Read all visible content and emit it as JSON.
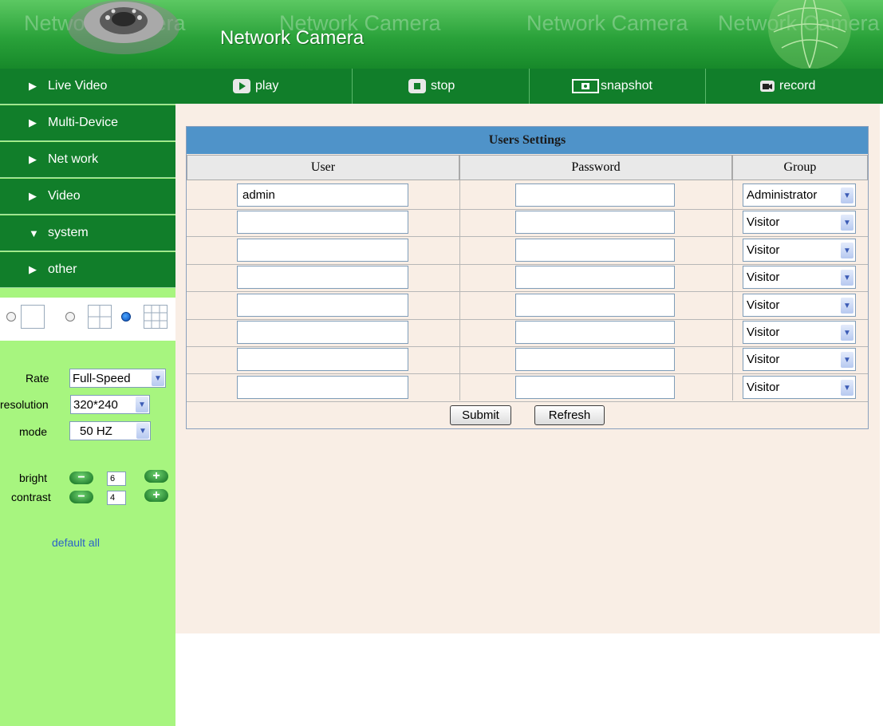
{
  "header": {
    "title": "Network Camera",
    "watermark": "Network Camera"
  },
  "toolbar": {
    "play_label": "play",
    "stop_label": "stop",
    "snapshot_label": "snapshot",
    "record_label": "record"
  },
  "sidebar": {
    "items": [
      {
        "label": "Live Video",
        "arrow": "▶"
      },
      {
        "label": "Multi-Device",
        "arrow": "▶"
      },
      {
        "label": "Net work",
        "arrow": "▶"
      },
      {
        "label": "Video",
        "arrow": "▶"
      },
      {
        "label": "system",
        "arrow": "▼"
      },
      {
        "label": "other",
        "arrow": "▶"
      }
    ],
    "view_mode_selected": 3,
    "rate_label": "Rate",
    "rate_value": "Full-Speed",
    "resolution_label": "resolution",
    "resolution_value": "320*240",
    "mode_label": "mode",
    "mode_value": "50 HZ",
    "bright_label": "bright",
    "bright_value": "6",
    "contrast_label": "contrast",
    "contrast_value": "4",
    "default_all": "default all"
  },
  "settings": {
    "title": "Users Settings",
    "columns": [
      "User",
      "Password",
      "Group"
    ],
    "rows": [
      {
        "user": "admin",
        "password": "",
        "group": "Administrator"
      },
      {
        "user": "",
        "password": "",
        "group": "Visitor"
      },
      {
        "user": "",
        "password": "",
        "group": "Visitor"
      },
      {
        "user": "",
        "password": "",
        "group": "Visitor"
      },
      {
        "user": "",
        "password": "",
        "group": "Visitor"
      },
      {
        "user": "",
        "password": "",
        "group": "Visitor"
      },
      {
        "user": "",
        "password": "",
        "group": "Visitor"
      },
      {
        "user": "",
        "password": "",
        "group": "Visitor"
      }
    ],
    "submit_label": "Submit",
    "refresh_label": "Refresh"
  },
  "colors": {
    "nav_green": "#117e2a",
    "sidebar_light": "#a7f57f",
    "panel_bg": "#f9eee5",
    "title_blue": "#4f93c9"
  }
}
